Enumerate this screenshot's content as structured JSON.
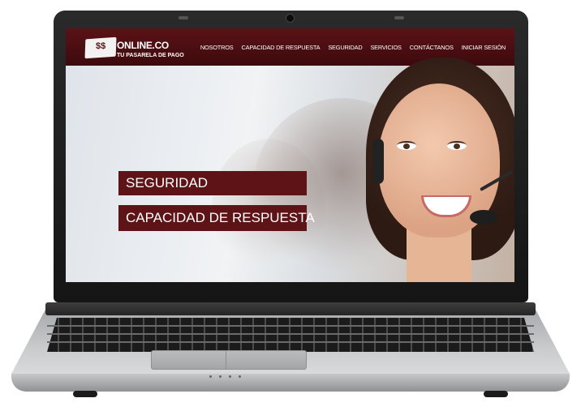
{
  "logo": {
    "badge": "$$",
    "name": "ONLINE.CO",
    "tagline": "TU PASARELA DE PAGO"
  },
  "nav": {
    "items": [
      {
        "label": "NOSOTROS"
      },
      {
        "label": "CAPACIDAD DE RESPUESTA"
      },
      {
        "label": "SEGURIDAD"
      },
      {
        "label": "SERVICIOS"
      },
      {
        "label": "CONTÁCTANOS"
      },
      {
        "label": "INICIAR SESIÓN"
      }
    ]
  },
  "hero": {
    "tags": [
      {
        "label": "SEGURIDAD"
      },
      {
        "label": "CAPACIDAD DE RESPUESTA"
      }
    ]
  },
  "colors": {
    "brand": "#5a1216",
    "brand_dark": "#3d0a0d",
    "text_light": "#ffffff"
  }
}
